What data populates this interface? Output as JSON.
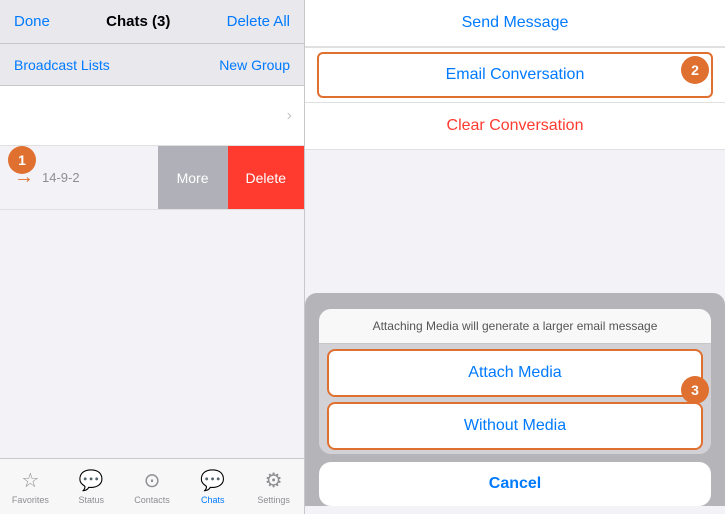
{
  "left": {
    "top_bar": {
      "done_label": "Done",
      "title": "Chats (3)",
      "delete_all_label": "Delete All"
    },
    "second_bar": {
      "broadcast_label": "Broadcast Lists",
      "new_group_label": "New Group"
    },
    "chat_item_date": "14-9-2",
    "swipe_buttons": {
      "more": "More",
      "delete": "Delete"
    },
    "annotation_1": "1"
  },
  "right": {
    "send_message_label": "Send Message",
    "email_conversation_label": "Email Conversation",
    "clear_conversation_label": "Clear Conversation",
    "annotation_2": "2",
    "annotation_3": "3",
    "dialog": {
      "subtitle": "Attaching Media will generate a larger email\nmessage",
      "attach_media_label": "Attach Media",
      "without_media_label": "Without Media",
      "cancel_label": "Cancel"
    }
  },
  "tab_bar": {
    "items": [
      {
        "icon": "★",
        "label": "Favorites",
        "active": false
      },
      {
        "icon": "💬",
        "label": "Status",
        "active": false
      },
      {
        "icon": "👤",
        "label": "Contacts",
        "active": false
      },
      {
        "icon": "💬",
        "label": "Chats",
        "active": true
      },
      {
        "icon": "⚙",
        "label": "Settings",
        "active": false
      }
    ]
  }
}
